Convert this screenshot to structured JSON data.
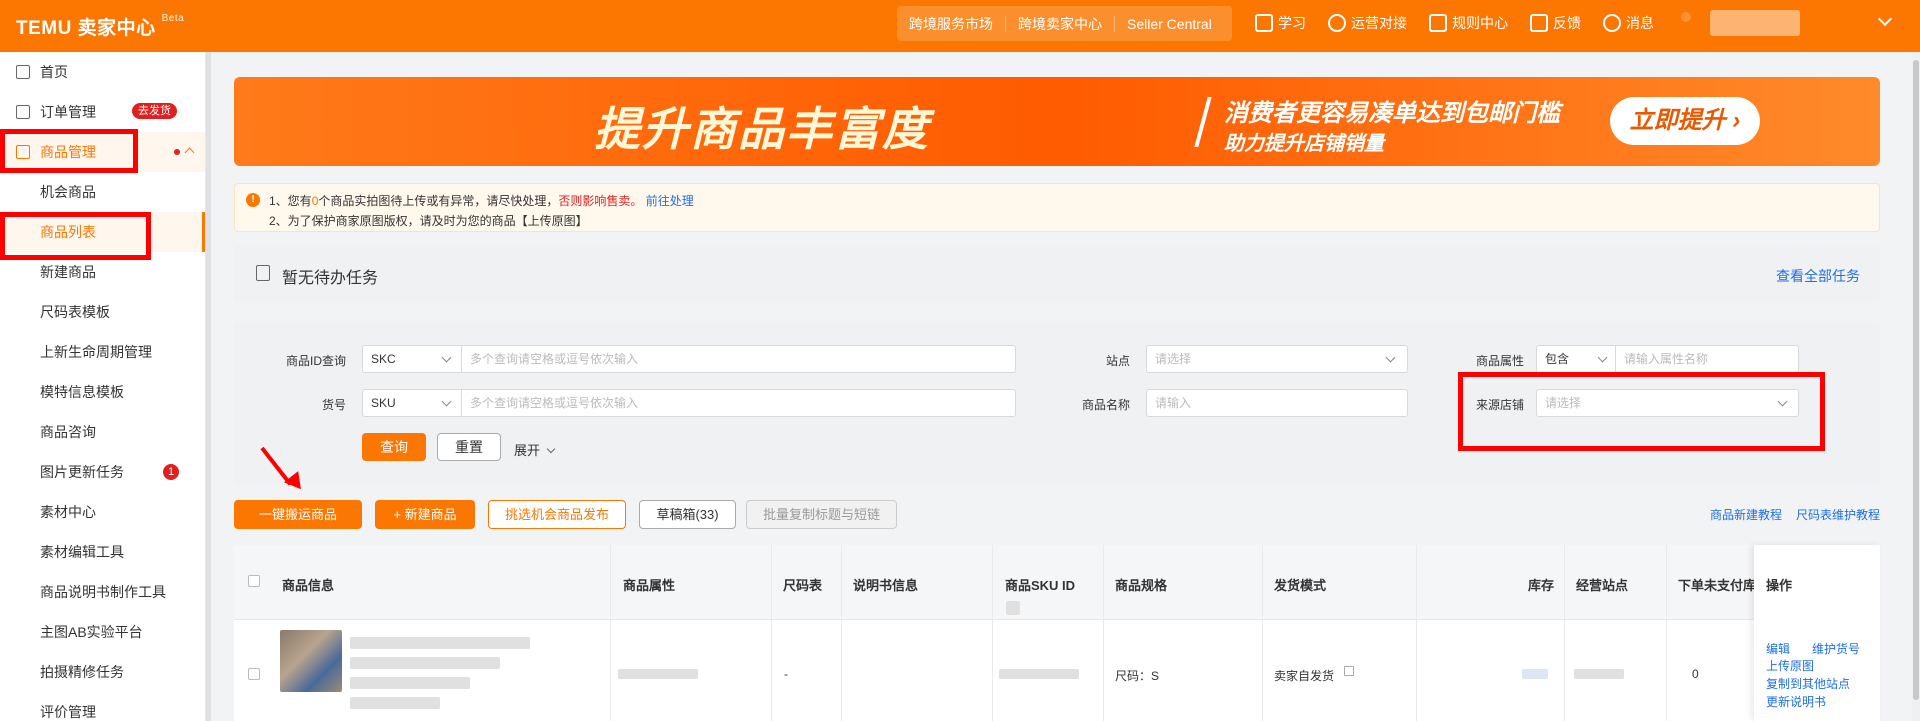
{
  "header": {
    "logo": "TEMU 卖家中心",
    "beta": "Beta",
    "segments": [
      "跨境服务市场",
      "跨境卖家中心",
      "Seller Central"
    ],
    "nav": [
      {
        "label": "学习",
        "icon": "book-icon"
      },
      {
        "label": "运营对接",
        "icon": "chat-icon"
      },
      {
        "label": "规则中心",
        "icon": "document-icon"
      },
      {
        "label": "反馈",
        "icon": "feedback-icon"
      },
      {
        "label": "消息",
        "icon": "bell-icon"
      }
    ]
  },
  "sidebar": {
    "items": [
      {
        "label": "首页",
        "icon": "home-icon"
      },
      {
        "label": "订单管理",
        "icon": "cart-icon",
        "badge": "去发货"
      },
      {
        "label": "商品管理",
        "icon": "product-icon"
      },
      {
        "label": "机会商品"
      },
      {
        "label": "商品列表"
      },
      {
        "label": "新建商品"
      },
      {
        "label": "尺码表模板"
      },
      {
        "label": "上新生命周期管理"
      },
      {
        "label": "模特信息模板"
      },
      {
        "label": "商品咨询"
      },
      {
        "label": "图片更新任务",
        "badge": "1"
      },
      {
        "label": "素材中心"
      },
      {
        "label": "素材编辑工具"
      },
      {
        "label": "商品说明书制作工具"
      },
      {
        "label": "主图AB实验平台"
      },
      {
        "label": "拍摄精修任务"
      },
      {
        "label": "评价管理"
      }
    ]
  },
  "banner": {
    "title": "提升商品丰富度",
    "line1": "消费者更容易凑单达到包邮门槛",
    "line2": "助力提升店铺销量",
    "button": "立即提升 ›"
  },
  "notice": {
    "l1_a": "1、您有",
    "l1_num": "0",
    "l1_b": "个商品实拍图待上传或有异常，请尽快处理，",
    "l1_warn": "否则影响售卖。",
    "l1_link": "前往处理",
    "l2": "2、为了保护商家原图版权，请及时为您的商品【上传原图】"
  },
  "task": {
    "title": "暂无待办任务",
    "link": "查看全部任务"
  },
  "filter": {
    "id_label": "商品ID查询",
    "id_type": "SKC",
    "id_placeholder": "多个查询请空格或逗号依次输入",
    "code_label": "货号",
    "code_type": "SKU",
    "code_placeholder": "多个查询请空格或逗号依次输入",
    "site_label": "站点",
    "site_placeholder": "请选择",
    "name_label": "商品名称",
    "name_placeholder": "请输入",
    "attr_label": "商品属性",
    "attr_type": "包含",
    "attr_placeholder": "请输入属性名称",
    "source_label": "来源店铺",
    "source_placeholder": "请选择",
    "search": "查询",
    "reset": "重置",
    "expand": "展开"
  },
  "toolbar": {
    "one_click": "一键搬运商品",
    "new_product": "+ 新建商品",
    "pick_opportunity": "挑选机会商品发布",
    "drafts": "草稿箱(33)",
    "batch_copy": "批量复制标题与短链",
    "tutorial": "商品新建教程",
    "size_tutorial": "尺码表维护教程"
  },
  "table": {
    "headers": [
      "商品信息",
      "商品属性",
      "尺码表",
      "说明书信息",
      "商品SKU ID",
      "商品规格",
      "发货模式",
      "库存",
      "经营站点",
      "下单未支付库",
      "操作"
    ],
    "row": {
      "size_table": "-",
      "spec": "尺码：S",
      "ship_mode": "卖家自发货",
      "stock": "0",
      "ops": [
        "编辑",
        "维护货号",
        "上传原图",
        "复制到其他站点",
        "更新说明书"
      ]
    }
  },
  "colors": {
    "brand": "#fb7701",
    "link": "#1f6fe0",
    "alert": "#ff0000"
  }
}
